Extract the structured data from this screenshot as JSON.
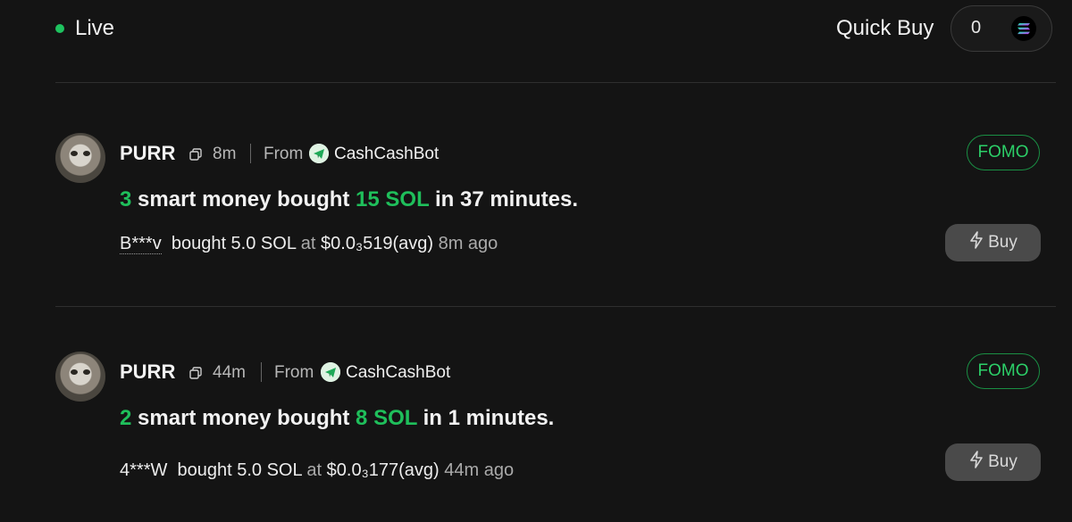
{
  "header": {
    "live_label": "Live",
    "quick_buy_label": "Quick Buy",
    "quick_buy_value": "0",
    "quick_buy_currency_icon": "solana-icon"
  },
  "cards": [
    {
      "token": "PURR",
      "age": "8m",
      "from_label": "From",
      "bot_name": "CashCashBot",
      "badge": "FOMO",
      "headline": {
        "count": "3",
        "text1": " smart money bought ",
        "amount": "15 SOL",
        "text2": " in 37 minutes."
      },
      "transactions": [
        {
          "wallet": "B***v",
          "text": "bought 5.0 SOL",
          "at": "at",
          "price": "$0.0₃519(avg)",
          "time": "8m ago"
        }
      ],
      "buy_label": "Buy"
    },
    {
      "token": "PURR",
      "age": "44m",
      "from_label": "From",
      "bot_name": "CashCashBot",
      "badge": "FOMO",
      "headline": {
        "count": "2",
        "text1": " smart money bought ",
        "amount": "8 SOL",
        "text2": " in 1 minutes."
      },
      "transactions": [
        {
          "wallet": "4***W",
          "text": "bought 5.0 SOL",
          "at": "at",
          "price": "$0.0₃177(avg)",
          "time": "44m ago"
        }
      ],
      "buy_label": "Buy"
    }
  ],
  "colors": {
    "accent_green": "#1fbf5b",
    "background": "#141414",
    "button_gray": "#4a4a4a"
  }
}
